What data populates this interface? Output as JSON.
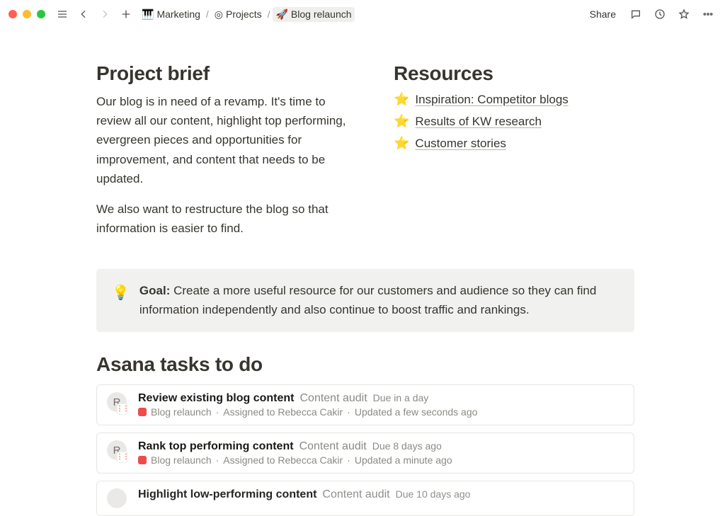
{
  "topbar": {
    "share_label": "Share"
  },
  "breadcrumb": {
    "items": [
      {
        "icon": "🎹",
        "label": "Marketing"
      },
      {
        "icon": "◎",
        "label": "Projects"
      },
      {
        "icon": "🚀",
        "label": "Blog relaunch"
      }
    ]
  },
  "brief": {
    "heading": "Project brief",
    "para1": "Our blog is in need of a revamp. It's time to review all our content, highlight top performing, evergreen pieces and opportunities for improvement, and content that needs to be updated.",
    "para2": "We also want to restructure the blog so that information is easier to find."
  },
  "resources": {
    "heading": "Resources",
    "items": [
      {
        "icon": "⭐",
        "label": "Inspiration: Competitor blogs"
      },
      {
        "icon": "⭐",
        "label": "Results of KW research"
      },
      {
        "icon": "⭐",
        "label": "Customer stories"
      }
    ]
  },
  "callout": {
    "icon": "💡",
    "label": "Goal:",
    "text": "Create a more useful resource for our customers and audience so they can find information independently and also continue to boost traffic and rankings."
  },
  "tasks": {
    "heading": "Asana tasks to do",
    "items": [
      {
        "avatar_initial": "R",
        "title": "Review existing blog content",
        "section": "Content audit",
        "due": "Due in a day",
        "project": "Blog relaunch",
        "assignee": "Assigned to Rebecca Cakir",
        "updated": "Updated a few seconds ago"
      },
      {
        "avatar_initial": "R",
        "title": "Rank top performing content",
        "section": "Content audit",
        "due": "Due 8 days ago",
        "project": "Blog relaunch",
        "assignee": "Assigned to Rebecca Cakir",
        "updated": "Updated a minute ago"
      },
      {
        "avatar_initial": "",
        "title": "Highlight low-performing content",
        "section": "Content audit",
        "due": "Due 10 days ago",
        "project": "",
        "assignee": "",
        "updated": ""
      }
    ],
    "meta_sep": " · "
  }
}
